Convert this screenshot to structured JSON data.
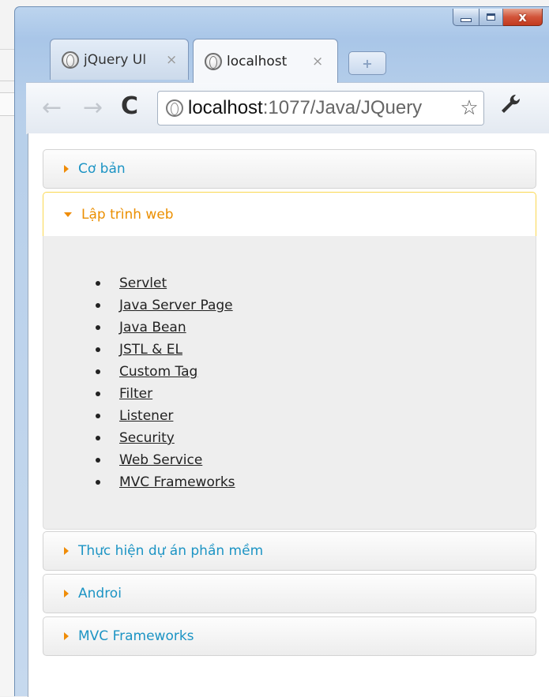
{
  "browser": {
    "tabs": [
      {
        "title": "jQuery UI",
        "close": "×"
      },
      {
        "title": "localhost",
        "close": "×"
      }
    ],
    "new_tab": "+",
    "controls": {
      "close": "x"
    },
    "nav": {
      "back": "←",
      "forward": "→",
      "reload": "C"
    },
    "address": {
      "host": "localhost",
      "path": ":1077/Java/JQuery"
    },
    "star": "☆",
    "wrench": "🔧"
  },
  "accordion": {
    "sections": [
      {
        "label": "Cơ bản"
      },
      {
        "label": "Lập trình web"
      },
      {
        "label": "Thực hiện dự án phần mềm"
      },
      {
        "label": "Androi"
      },
      {
        "label": "MVC Frameworks"
      }
    ],
    "web_items": [
      "Servlet",
      "Java Server Page",
      "Java Bean",
      "JSTL & EL",
      "Custom Tag",
      "Filter",
      "Listener",
      "Security",
      "Web Service",
      "MVC Frameworks"
    ],
    "colors": {
      "header_text": "#1c94c4",
      "active_text": "#eb8f00",
      "icon": "#ef8c08"
    }
  }
}
